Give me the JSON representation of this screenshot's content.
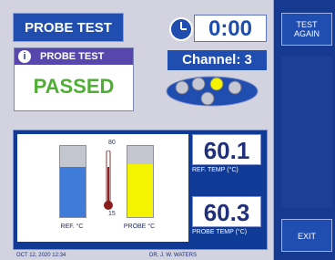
{
  "title_button": "PROBE TEST",
  "timer": "0:00",
  "channel": "Channel: 3",
  "result_box": {
    "header": "PROBE TEST",
    "status": "PASSED"
  },
  "sidebar": {
    "test_again_line1": "TEST",
    "test_again_line2": "AGAIN",
    "exit": "EXIT"
  },
  "gauge": {
    "scale_top": "80",
    "scale_bottom": "15",
    "ref_label": "REF. °C",
    "probe_label": "PROBE °C",
    "ref_fill": 0.7,
    "probe_fill": 0.75,
    "ref_color": "#3f7bd8",
    "probe_color": "#f4f400"
  },
  "readings": {
    "ref_value": "60.1",
    "ref_label": "REF. TEMP (°C)",
    "probe_value": "60.3",
    "probe_label": "PROBE TEMP (°C)"
  },
  "status_bar": {
    "left": "OCT 12, 2020 12:34",
    "right": "DR. J. W. WATERS"
  },
  "colors": {
    "accent": "#1f4db0",
    "pass": "#4fae34",
    "header": "#5747ad"
  }
}
